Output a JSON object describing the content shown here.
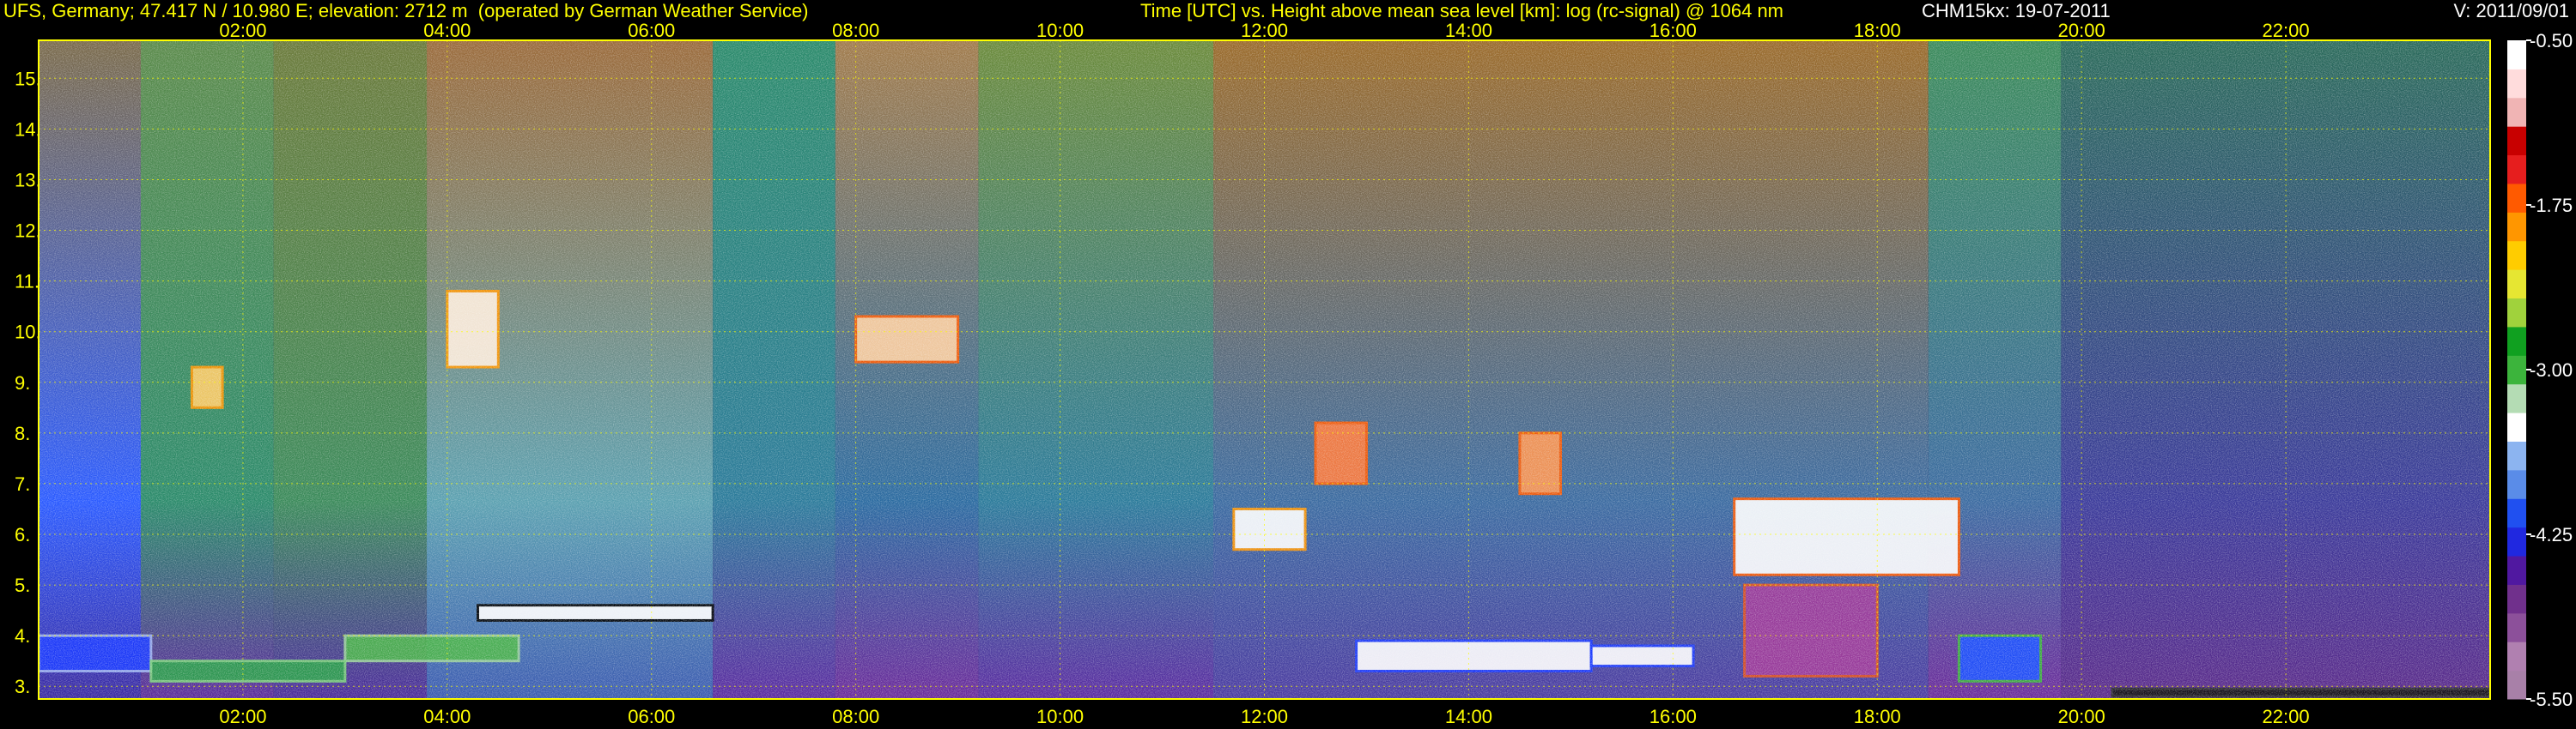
{
  "header": {
    "site": "UFS, Germany; 47.417 N / 10.980 E; elevation: 2712 m  (operated by German Weather Service)",
    "plot_title": "Time [UTC] vs. Height above mean sea level [km]: log (rc-signal) @ 1064 nm",
    "instrument_date": "CHM15kx: 19-07-2011",
    "version": "V: 2011/09/01"
  },
  "colors": {
    "background": "#000000",
    "header_text": "#ffff00",
    "grid": "#ffff00",
    "colorbar_labels": "#ffffff"
  },
  "chart_data": {
    "type": "heatmap",
    "title": "Time [UTC] vs. Height above mean sea level [km]: log (rc-signal) @ 1064 nm",
    "xlabel": "Time [UTC]",
    "ylabel": "Height above mean sea level [km]",
    "x_ticks": [
      "02:00",
      "04:00",
      "06:00",
      "08:00",
      "10:00",
      "12:00",
      "14:00",
      "16:00",
      "18:00",
      "20:00",
      "22:00"
    ],
    "x_tick_hours": [
      2,
      4,
      6,
      8,
      10,
      12,
      14,
      16,
      18,
      20,
      22
    ],
    "xlim_hours": [
      0,
      24
    ],
    "y_ticks": [
      "3.",
      "4.",
      "5.",
      "6.",
      "7.",
      "8.",
      "9.",
      "10.",
      "11.",
      "12.",
      "13.",
      "14.",
      "15."
    ],
    "y_tick_values": [
      3,
      4,
      5,
      6,
      7,
      8,
      9,
      10,
      11,
      12,
      13,
      14,
      15
    ],
    "ylim_km": [
      2.75,
      15.75
    ],
    "grid": true,
    "colorbar": {
      "ticks": [
        "-0.50",
        "-1.75",
        "-3.00",
        "-4.25",
        "-5.50"
      ],
      "tick_values": [
        -0.5,
        -1.75,
        -3.0,
        -4.25,
        -5.5
      ],
      "range": [
        -5.5,
        -0.5
      ],
      "colors": [
        "#a880a8",
        "#b080b0",
        "#8c509a",
        "#70308c",
        "#5018a0",
        "#2028e0",
        "#2050f0",
        "#5a8ce8",
        "#8cb4f0",
        "#ffffff",
        "#b4dcb4",
        "#3cb43c",
        "#10a020",
        "#a0d23c",
        "#e6e632",
        "#ffcc00",
        "#ff9600",
        "#ff5a00",
        "#e61e1e",
        "#c80000",
        "#f0b4b4",
        "#ffdcdc",
        "#ffffff"
      ]
    },
    "columns": [
      {
        "t0": 0.0,
        "t1": 1.0,
        "base": "#3a2aa0",
        "low": "#2a5aff",
        "top": "#7a6a4a"
      },
      {
        "t0": 1.0,
        "t1": 2.3,
        "base": "#5a2a9a",
        "low": "#2a8a6a",
        "top": "#5a8a4a"
      },
      {
        "t0": 2.3,
        "t1": 3.8,
        "base": "#4a2a9a",
        "low": "#3a8a5a",
        "top": "#6a7a3a"
      },
      {
        "t0": 3.8,
        "t1": 6.6,
        "base": "#3a5ab0",
        "low": "#5aa0b0",
        "top": "#9a6a3a"
      },
      {
        "t0": 6.6,
        "t1": 7.8,
        "base": "#5a2aa0",
        "low": "#2a7a9a",
        "top": "#2a8a6a"
      },
      {
        "t0": 7.8,
        "t1": 9.2,
        "base": "#6a2a9a",
        "low": "#2a6aa0",
        "top": "#a07a4a"
      },
      {
        "t0": 9.2,
        "t1": 11.5,
        "base": "#5a2aa0",
        "low": "#2a7a9a",
        "top": "#6a8a3a"
      },
      {
        "t0": 11.5,
        "t1": 18.5,
        "base": "#4a3aa0",
        "low": "#3a6aa0",
        "top": "#9a6a2a"
      },
      {
        "t0": 18.5,
        "t1": 19.8,
        "base": "#6a2a9a",
        "low": "#3a6aa0",
        "top": "#3a8a5a"
      },
      {
        "t0": 19.8,
        "t1": 24.0,
        "base": "#5a2a8a",
        "low": "#3a3a9a",
        "top": "#2a6a5a"
      }
    ],
    "cloud_layers": [
      {
        "t0": 4.3,
        "t1": 6.6,
        "h0": 4.3,
        "h1": 4.6,
        "color": "#ffffff",
        "edge": "#000000"
      },
      {
        "t0": 3.0,
        "t1": 4.7,
        "h0": 3.5,
        "h1": 4.0,
        "color": "#4ab44a",
        "edge": "#9ad09a"
      },
      {
        "t0": 0.0,
        "t1": 1.1,
        "h0": 3.3,
        "h1": 4.0,
        "color": "#1a3aff",
        "edge": "#9ab0f0"
      },
      {
        "t0": 1.1,
        "t1": 3.0,
        "h0": 3.1,
        "h1": 3.5,
        "color": "#2aa04a",
        "edge": "#7ad07a"
      },
      {
        "t0": 12.9,
        "t1": 15.2,
        "h0": 3.3,
        "h1": 3.9,
        "color": "#ffffff",
        "edge": "#1a3aff"
      },
      {
        "t0": 15.2,
        "t1": 16.2,
        "h0": 3.4,
        "h1": 3.8,
        "color": "#ffffff",
        "edge": "#1a3aff"
      },
      {
        "t0": 16.6,
        "t1": 18.8,
        "h0": 5.2,
        "h1": 6.7,
        "color": "#ffffff",
        "edge": "#ff5a00"
      },
      {
        "t0": 16.7,
        "t1": 18.0,
        "h0": 3.2,
        "h1": 5.0,
        "color": "#a03a9a",
        "edge": "#e0501e"
      },
      {
        "t0": 18.8,
        "t1": 19.6,
        "h0": 3.1,
        "h1": 4.0,
        "color": "#1a50ff",
        "edge": "#3cb43c"
      },
      {
        "t0": 11.7,
        "t1": 12.4,
        "h0": 5.7,
        "h1": 6.5,
        "color": "#ffffff",
        "edge": "#ff9600"
      },
      {
        "t0": 4.0,
        "t1": 4.5,
        "h0": 9.3,
        "h1": 10.8,
        "color": "#ffeedd",
        "edge": "#ff9600"
      },
      {
        "t0": 1.5,
        "t1": 1.8,
        "h0": 8.5,
        "h1": 9.3,
        "color": "#ffcc66",
        "edge": "#ff9600"
      },
      {
        "t0": 8.0,
        "t1": 9.0,
        "h0": 9.4,
        "h1": 10.3,
        "color": "#ffd0a0",
        "edge": "#ff5a00"
      },
      {
        "t0": 14.5,
        "t1": 14.9,
        "h0": 6.8,
        "h1": 8.0,
        "color": "#ff9650",
        "edge": "#ff5a00"
      },
      {
        "t0": 12.5,
        "t1": 13.0,
        "h0": 7.0,
        "h1": 8.2,
        "color": "#ff7a3a",
        "edge": "#ff5a00"
      },
      {
        "t0": 20.3,
        "t1": 24.0,
        "h0": 2.8,
        "h1": 2.95,
        "color": "#101010",
        "edge": "#2a2a2a"
      }
    ]
  }
}
